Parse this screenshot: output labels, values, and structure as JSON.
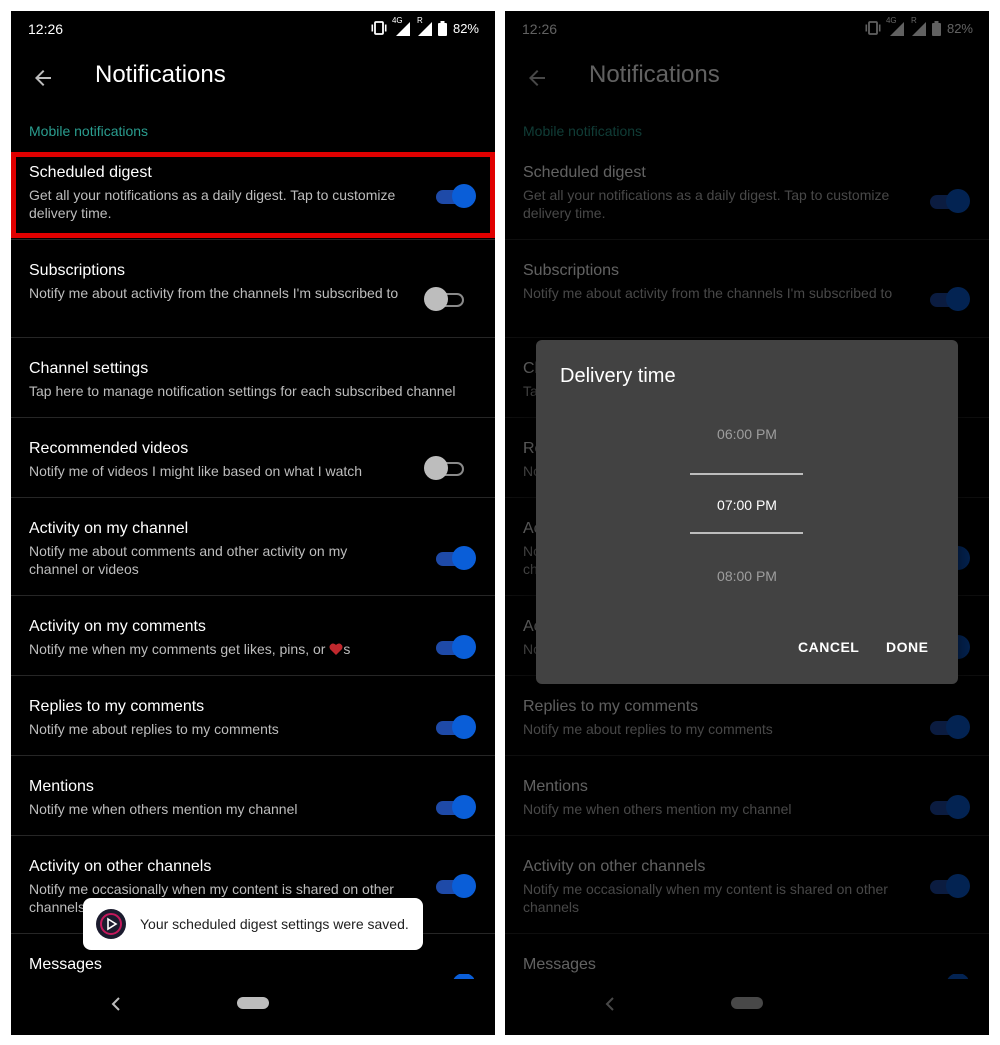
{
  "status": {
    "time": "12:26",
    "network": "4G",
    "roaming": "R",
    "battery": "82%"
  },
  "header": {
    "title": "Notifications"
  },
  "section": {
    "mobile": "Mobile notifications"
  },
  "settings": [
    {
      "label": "Scheduled digest",
      "desc": "Get all your notifications as a daily digest. Tap to customize delivery time.",
      "toggle": "on",
      "toggle_right": "on"
    },
    {
      "label": "Subscriptions",
      "desc": "Notify me about activity from the channels I'm subscribed to",
      "toggle": "off",
      "toggle_right": "on"
    },
    {
      "label": "Channel settings",
      "desc": "Tap here to manage notification settings for each subscribed channel"
    },
    {
      "label": "Recommended videos",
      "desc": "Notify me of videos I might like based on what I watch",
      "toggle": "off"
    },
    {
      "label": "Activity on my channel",
      "desc": "Notify me about comments and other activity on my channel or videos",
      "toggle": "on"
    },
    {
      "label": "Activity on my comments",
      "desc": "Notify me when my comments get likes, pins, or",
      "desc_suffix": "s",
      "toggle": "on"
    },
    {
      "label": "Replies to my comments",
      "desc": "Notify me about replies to my comments",
      "toggle": "on"
    },
    {
      "label": "Mentions",
      "desc": "Notify me when others mention my channel",
      "toggle": "on"
    },
    {
      "label": "Activity on other channels",
      "desc": "Notify me occasionally when my content is shared on other channels",
      "toggle": "on"
    },
    {
      "label": "Messages"
    }
  ],
  "toast": {
    "text": "Your scheduled digest settings were saved."
  },
  "dialog": {
    "title": "Delivery time",
    "options": [
      "06:00 PM",
      "07:00 PM",
      "08:00 PM"
    ],
    "selected": "07:00 PM",
    "cancel": "CANCEL",
    "done": "DONE"
  },
  "colors": {
    "accent": "#2a9d8f",
    "toggle_on": "#0a5ed8",
    "highlight": "#e00000",
    "dialog_bg": "#424242"
  },
  "icons": [
    "back-arrow-icon",
    "vibrate-icon",
    "signal-icon",
    "battery-icon",
    "heart-icon",
    "youtube-logo-icon",
    "nav-back-icon"
  ]
}
